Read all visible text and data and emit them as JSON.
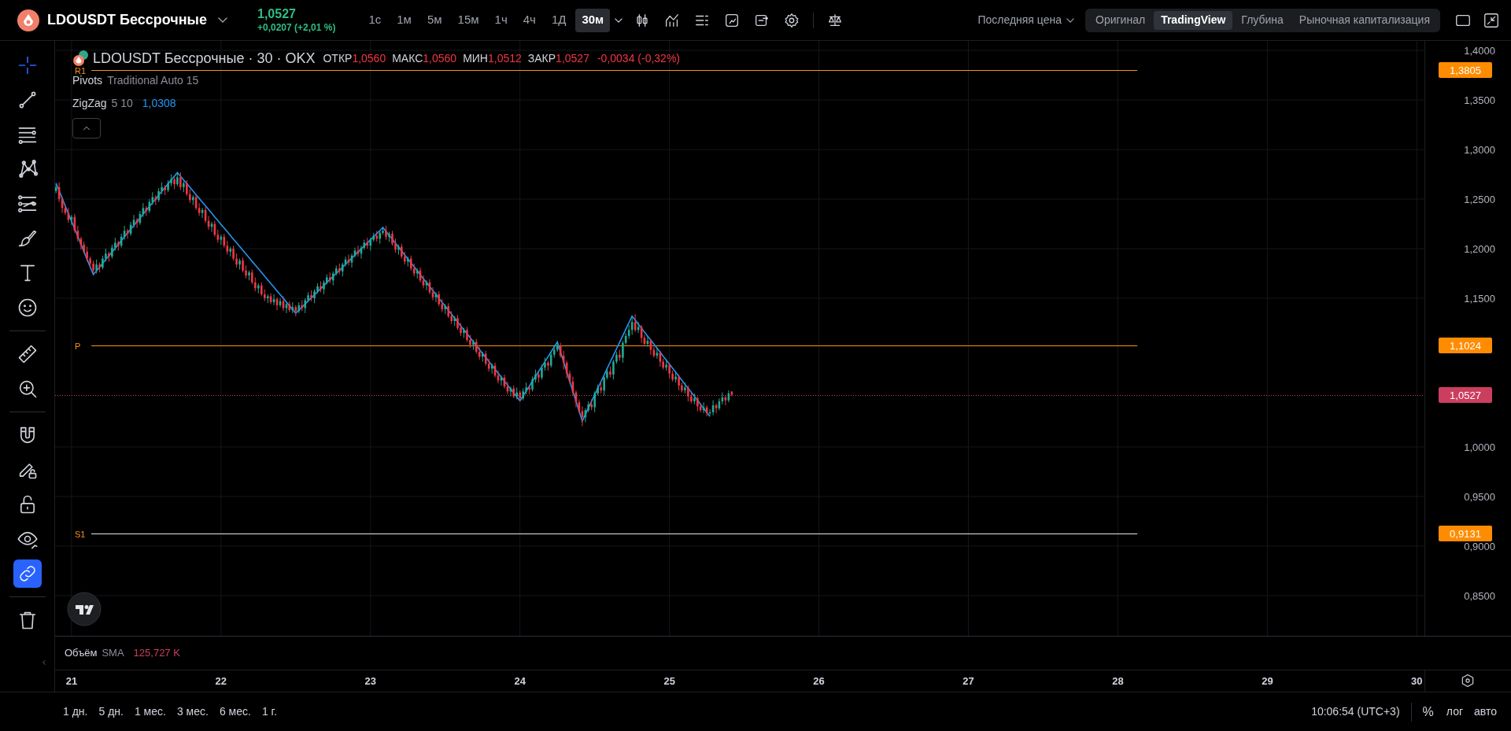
{
  "header": {
    "symbol": "LDOUSDT Бессрочные",
    "price": "1,0527",
    "change": "+0,0207 (+2,01 %)",
    "timeframes": [
      {
        "label": "1с",
        "selected": false
      },
      {
        "label": "1м",
        "selected": false
      },
      {
        "label": "5м",
        "selected": false
      },
      {
        "label": "15м",
        "selected": false
      },
      {
        "label": "1ч",
        "selected": false
      },
      {
        "label": "4ч",
        "selected": false
      },
      {
        "label": "1Д",
        "selected": false
      },
      {
        "label": "30м",
        "selected": true
      }
    ],
    "price_source": "Последняя цена",
    "views": [
      {
        "label": "Оригинал",
        "selected": false
      },
      {
        "label": "TradingView",
        "selected": true
      },
      {
        "label": "Глубина",
        "selected": false
      },
      {
        "label": "Рыночная капитализация",
        "selected": false
      }
    ]
  },
  "toolbar": {
    "tools": [
      {
        "selected": true
      },
      {
        "selected": false
      },
      {
        "selected": false
      },
      {
        "selected": false
      },
      {
        "selected": false
      },
      {
        "selected": false
      },
      {
        "selected": false
      },
      {
        "selected": false
      }
    ],
    "link_drawings": {
      "on": true
    }
  },
  "legend": {
    "symbol": "LDOUSDT Бессрочные · 30 · OKX",
    "ohlc": [
      {
        "label": "ОТКР",
        "value": "1,0560"
      },
      {
        "label": "МАКС",
        "value": "1,0560"
      },
      {
        "label": "МИН",
        "value": "1,0512"
      },
      {
        "label": "ЗАКР",
        "value": "1,0527"
      }
    ],
    "change": "-0,0034 (-0,32%)",
    "indicators": [
      {
        "name": "Pivots",
        "params": "Traditional Auto 15"
      },
      {
        "params": "5 10",
        "value": "1,0308"
      }
    ]
  },
  "chart": {
    "chart_data": {
      "type": "candlestick",
      "grid": true,
      "x": [
        20.896,
        20.917,
        20.938,
        20.958,
        20.979,
        21.0,
        21.021,
        21.042,
        21.063,
        21.083,
        21.104,
        21.125,
        21.146,
        21.167,
        21.188,
        21.208,
        21.229,
        21.25,
        21.271,
        21.292,
        21.313,
        21.333,
        21.354,
        21.375,
        21.396,
        21.417,
        21.438,
        21.458,
        21.479,
        21.5,
        21.521,
        21.542,
        21.563,
        21.583,
        21.604,
        21.625,
        21.646,
        21.667,
        21.688,
        21.708,
        21.729,
        21.75,
        21.771,
        21.792,
        21.813,
        21.833,
        21.854,
        21.875,
        21.896,
        21.917,
        21.938,
        21.958,
        21.979,
        22.0,
        22.021,
        22.042,
        22.063,
        22.083,
        22.104,
        22.125,
        22.146,
        22.167,
        22.188,
        22.208,
        22.229,
        22.25,
        22.271,
        22.292,
        22.313,
        22.333,
        22.354,
        22.375,
        22.396,
        22.417,
        22.438,
        22.458,
        22.479,
        22.5,
        22.521,
        22.542,
        22.563,
        22.583,
        22.604,
        22.625,
        22.646,
        22.667,
        22.688,
        22.708,
        22.729,
        22.75,
        22.771,
        22.792,
        22.813,
        22.833,
        22.854,
        22.875,
        22.896,
        22.917,
        22.938,
        22.958,
        22.979,
        23.0,
        23.021,
        23.042,
        23.063,
        23.083,
        23.104,
        23.125,
        23.146,
        23.167,
        23.188,
        23.208,
        23.229,
        23.25,
        23.271,
        23.292,
        23.313,
        23.333,
        23.354,
        23.375,
        23.396,
        23.417,
        23.438,
        23.458,
        23.479,
        23.5,
        23.521,
        23.542,
        23.563,
        23.583,
        23.604,
        23.625,
        23.646,
        23.667,
        23.688,
        23.708,
        23.729,
        23.75,
        23.771,
        23.792,
        23.813,
        23.833,
        23.854,
        23.875,
        23.896,
        23.917,
        23.938,
        23.958,
        23.979,
        24.0,
        24.021,
        24.042,
        24.063,
        24.083,
        24.104,
        24.125,
        24.146,
        24.167,
        24.188,
        24.208,
        24.229,
        24.25,
        24.271,
        24.292,
        24.313,
        24.333,
        24.354,
        24.375,
        24.396,
        24.417,
        24.438,
        24.458,
        24.479,
        24.5,
        24.521,
        24.542,
        24.563,
        24.583,
        24.604,
        24.625,
        24.646,
        24.667,
        24.688,
        24.708,
        24.729,
        24.75,
        24.771,
        24.792,
        24.813,
        24.833,
        24.854,
        24.875,
        24.896,
        24.917,
        24.938,
        24.958,
        24.979,
        25.0,
        25.021,
        25.042,
        25.063,
        25.083,
        25.104,
        25.125,
        25.146,
        25.167,
        25.188,
        25.208,
        25.229,
        25.25,
        25.271,
        25.292,
        25.313,
        25.333,
        25.354,
        25.375,
        25.396,
        25.417
      ],
      "ohlc": [
        [
          1.258,
          1.265,
          1.256,
          1.262
        ],
        [
          1.262,
          1.267,
          1.247,
          1.25
        ],
        [
          1.25,
          1.252,
          1.236,
          1.241
        ],
        [
          1.241,
          1.244,
          1.234,
          1.236
        ],
        [
          1.236,
          1.241,
          1.226,
          1.229
        ],
        [
          1.229,
          1.234,
          1.224,
          1.232
        ],
        [
          1.232,
          1.235,
          1.216,
          1.218
        ],
        [
          1.218,
          1.223,
          1.207,
          1.21
        ],
        [
          1.21,
          1.212,
          1.199,
          1.204
        ],
        [
          1.204,
          1.207,
          1.195,
          1.197
        ],
        [
          1.197,
          1.202,
          1.187,
          1.19
        ],
        [
          1.19,
          1.192,
          1.18,
          1.185
        ],
        [
          1.185,
          1.188,
          1.174,
          1.178
        ],
        [
          1.178,
          1.189,
          1.175,
          1.184
        ],
        [
          1.184,
          1.186,
          1.176,
          1.181
        ],
        [
          1.181,
          1.193,
          1.179,
          1.19
        ],
        [
          1.19,
          1.2,
          1.187,
          1.195
        ],
        [
          1.195,
          1.197,
          1.187,
          1.192
        ],
        [
          1.192,
          1.204,
          1.19,
          1.201
        ],
        [
          1.201,
          1.211,
          1.198,
          1.206
        ],
        [
          1.206,
          1.208,
          1.198,
          1.203
        ],
        [
          1.203,
          1.215,
          1.201,
          1.212
        ],
        [
          1.212,
          1.223,
          1.209,
          1.218
        ],
        [
          1.218,
          1.22,
          1.21,
          1.215
        ],
        [
          1.215,
          1.227,
          1.213,
          1.224
        ],
        [
          1.224,
          1.234,
          1.221,
          1.229
        ],
        [
          1.229,
          1.231,
          1.221,
          1.226
        ],
        [
          1.226,
          1.238,
          1.224,
          1.235
        ],
        [
          1.235,
          1.246,
          1.232,
          1.241
        ],
        [
          1.241,
          1.243,
          1.233,
          1.238
        ],
        [
          1.238,
          1.25,
          1.236,
          1.247
        ],
        [
          1.247,
          1.257,
          1.244,
          1.252
        ],
        [
          1.252,
          1.254,
          1.244,
          1.249
        ],
        [
          1.249,
          1.261,
          1.247,
          1.258
        ],
        [
          1.258,
          1.267,
          1.255,
          1.262
        ],
        [
          1.262,
          1.264,
          1.254,
          1.259
        ],
        [
          1.259,
          1.269,
          1.257,
          1.266
        ],
        [
          1.266,
          1.275,
          1.263,
          1.27
        ],
        [
          1.27,
          1.272,
          1.26,
          1.265
        ],
        [
          1.265,
          1.277,
          1.263,
          1.272
        ],
        [
          1.272,
          1.277,
          1.259,
          1.262
        ],
        [
          1.262,
          1.268,
          1.257,
          1.266
        ],
        [
          1.266,
          1.269,
          1.253,
          1.255
        ],
        [
          1.255,
          1.26,
          1.246,
          1.249
        ],
        [
          1.249,
          1.254,
          1.244,
          1.252
        ],
        [
          1.252,
          1.255,
          1.239,
          1.241
        ],
        [
          1.241,
          1.246,
          1.233,
          1.236
        ],
        [
          1.236,
          1.241,
          1.231,
          1.239
        ],
        [
          1.239,
          1.242,
          1.226,
          1.228
        ],
        [
          1.228,
          1.233,
          1.219,
          1.222
        ],
        [
          1.222,
          1.227,
          1.217,
          1.225
        ],
        [
          1.225,
          1.228,
          1.212,
          1.214
        ],
        [
          1.214,
          1.219,
          1.206,
          1.209
        ],
        [
          1.209,
          1.214,
          1.204,
          1.212
        ],
        [
          1.212,
          1.215,
          1.201,
          1.203
        ],
        [
          1.203,
          1.208,
          1.194,
          1.197
        ],
        [
          1.197,
          1.202,
          1.192,
          1.2
        ],
        [
          1.2,
          1.203,
          1.188,
          1.19
        ],
        [
          1.19,
          1.195,
          1.181,
          1.184
        ],
        [
          1.184,
          1.19,
          1.179,
          1.188
        ],
        [
          1.188,
          1.191,
          1.176,
          1.178
        ],
        [
          1.178,
          1.183,
          1.17,
          1.173
        ],
        [
          1.173,
          1.178,
          1.168,
          1.176
        ],
        [
          1.176,
          1.179,
          1.164,
          1.166
        ],
        [
          1.166,
          1.171,
          1.157,
          1.16
        ],
        [
          1.16,
          1.165,
          1.155,
          1.163
        ],
        [
          1.163,
          1.166,
          1.152,
          1.154
        ],
        [
          1.154,
          1.159,
          1.147,
          1.15
        ],
        [
          1.15,
          1.154,
          1.145,
          1.152
        ],
        [
          1.152,
          1.155,
          1.144,
          1.146
        ],
        [
          1.146,
          1.154,
          1.143,
          1.149
        ],
        [
          1.149,
          1.151,
          1.138,
          1.143
        ],
        [
          1.143,
          1.15,
          1.141,
          1.147
        ],
        [
          1.147,
          1.152,
          1.137,
          1.14
        ],
        [
          1.14,
          1.146,
          1.135,
          1.144
        ],
        [
          1.144,
          1.147,
          1.136,
          1.138
        ],
        [
          1.138,
          1.146,
          1.135,
          1.141
        ],
        [
          1.141,
          1.143,
          1.132,
          1.137
        ],
        [
          1.137,
          1.146,
          1.135,
          1.143
        ],
        [
          1.143,
          1.148,
          1.137,
          1.14
        ],
        [
          1.14,
          1.15,
          1.135,
          1.148
        ],
        [
          1.148,
          1.156,
          1.146,
          1.153
        ],
        [
          1.153,
          1.158,
          1.147,
          1.15
        ],
        [
          1.15,
          1.159,
          1.145,
          1.157
        ],
        [
          1.157,
          1.165,
          1.155,
          1.162
        ],
        [
          1.162,
          1.167,
          1.156,
          1.159
        ],
        [
          1.159,
          1.168,
          1.154,
          1.166
        ],
        [
          1.166,
          1.174,
          1.164,
          1.171
        ],
        [
          1.171,
          1.176,
          1.165,
          1.168
        ],
        [
          1.168,
          1.177,
          1.163,
          1.175
        ],
        [
          1.175,
          1.183,
          1.173,
          1.18
        ],
        [
          1.18,
          1.185,
          1.174,
          1.177
        ],
        [
          1.177,
          1.186,
          1.172,
          1.184
        ],
        [
          1.184,
          1.192,
          1.182,
          1.189
        ],
        [
          1.189,
          1.194,
          1.183,
          1.186
        ],
        [
          1.186,
          1.195,
          1.181,
          1.193
        ],
        [
          1.193,
          1.201,
          1.191,
          1.198
        ],
        [
          1.198,
          1.203,
          1.192,
          1.195
        ],
        [
          1.195,
          1.203,
          1.19,
          1.201
        ],
        [
          1.201,
          1.209,
          1.199,
          1.206
        ],
        [
          1.206,
          1.211,
          1.2,
          1.203
        ],
        [
          1.203,
          1.211,
          1.198,
          1.209
        ],
        [
          1.209,
          1.216,
          1.207,
          1.213
        ],
        [
          1.213,
          1.218,
          1.207,
          1.21
        ],
        [
          1.21,
          1.218,
          1.205,
          1.216
        ],
        [
          1.216,
          1.221,
          1.214,
          1.218
        ],
        [
          1.218,
          1.223,
          1.209,
          1.212
        ],
        [
          1.212,
          1.217,
          1.207,
          1.215
        ],
        [
          1.215,
          1.218,
          1.203,
          1.205
        ],
        [
          1.205,
          1.21,
          1.196,
          1.199
        ],
        [
          1.199,
          1.204,
          1.194,
          1.202
        ],
        [
          1.202,
          1.205,
          1.19,
          1.192
        ],
        [
          1.192,
          1.197,
          1.184,
          1.187
        ],
        [
          1.187,
          1.192,
          1.182,
          1.19
        ],
        [
          1.19,
          1.193,
          1.178,
          1.18
        ],
        [
          1.18,
          1.185,
          1.172,
          1.175
        ],
        [
          1.175,
          1.18,
          1.17,
          1.178
        ],
        [
          1.178,
          1.181,
          1.166,
          1.168
        ],
        [
          1.168,
          1.173,
          1.16,
          1.163
        ],
        [
          1.163,
          1.168,
          1.158,
          1.166
        ],
        [
          1.166,
          1.169,
          1.154,
          1.156
        ],
        [
          1.156,
          1.161,
          1.148,
          1.151
        ],
        [
          1.151,
          1.156,
          1.146,
          1.154
        ],
        [
          1.154,
          1.157,
          1.142,
          1.144
        ],
        [
          1.144,
          1.149,
          1.136,
          1.139
        ],
        [
          1.139,
          1.144,
          1.134,
          1.142
        ],
        [
          1.142,
          1.145,
          1.13,
          1.132
        ],
        [
          1.132,
          1.137,
          1.124,
          1.127
        ],
        [
          1.127,
          1.132,
          1.122,
          1.13
        ],
        [
          1.13,
          1.133,
          1.118,
          1.12
        ],
        [
          1.12,
          1.125,
          1.112,
          1.115
        ],
        [
          1.115,
          1.12,
          1.11,
          1.118
        ],
        [
          1.118,
          1.121,
          1.106,
          1.108
        ],
        [
          1.108,
          1.113,
          1.1,
          1.103
        ],
        [
          1.103,
          1.108,
          1.098,
          1.106
        ],
        [
          1.106,
          1.109,
          1.094,
          1.096
        ],
        [
          1.096,
          1.101,
          1.088,
          1.091
        ],
        [
          1.091,
          1.096,
          1.086,
          1.094
        ],
        [
          1.094,
          1.097,
          1.082,
          1.084
        ],
        [
          1.084,
          1.089,
          1.076,
          1.079
        ],
        [
          1.079,
          1.084,
          1.074,
          1.082
        ],
        [
          1.082,
          1.085,
          1.07,
          1.072
        ],
        [
          1.072,
          1.077,
          1.064,
          1.067
        ],
        [
          1.067,
          1.072,
          1.062,
          1.07
        ],
        [
          1.07,
          1.073,
          1.059,
          1.061
        ],
        [
          1.061,
          1.066,
          1.053,
          1.056
        ],
        [
          1.056,
          1.061,
          1.051,
          1.059
        ],
        [
          1.059,
          1.062,
          1.049,
          1.051
        ],
        [
          1.051,
          1.06,
          1.048,
          1.055
        ],
        [
          1.055,
          1.057,
          1.046,
          1.049
        ],
        [
          1.049,
          1.059,
          1.047,
          1.056
        ],
        [
          1.056,
          1.065,
          1.053,
          1.06
        ],
        [
          1.06,
          1.062,
          1.053,
          1.058
        ],
        [
          1.058,
          1.071,
          1.056,
          1.068
        ],
        [
          1.068,
          1.078,
          1.065,
          1.073
        ],
        [
          1.073,
          1.075,
          1.065,
          1.07
        ],
        [
          1.07,
          1.083,
          1.068,
          1.08
        ],
        [
          1.08,
          1.09,
          1.077,
          1.085
        ],
        [
          1.085,
          1.087,
          1.077,
          1.082
        ],
        [
          1.082,
          1.096,
          1.08,
          1.093
        ],
        [
          1.093,
          1.103,
          1.09,
          1.098
        ],
        [
          1.098,
          1.106,
          1.096,
          1.102
        ],
        [
          1.102,
          1.105,
          1.09,
          1.092
        ],
        [
          1.092,
          1.097,
          1.078,
          1.085
        ],
        [
          1.085,
          1.087,
          1.069,
          1.074
        ],
        [
          1.074,
          1.077,
          1.064,
          1.066
        ],
        [
          1.066,
          1.071,
          1.052,
          1.055
        ],
        [
          1.055,
          1.057,
          1.04,
          1.045
        ],
        [
          1.045,
          1.048,
          1.034,
          1.036
        ],
        [
          1.036,
          1.041,
          1.021,
          1.03
        ],
        [
          1.03,
          1.039,
          1.025,
          1.037
        ],
        [
          1.037,
          1.046,
          1.035,
          1.043
        ],
        [
          1.043,
          1.048,
          1.037,
          1.04
        ],
        [
          1.04,
          1.056,
          1.035,
          1.054
        ],
        [
          1.054,
          1.063,
          1.052,
          1.06
        ],
        [
          1.06,
          1.065,
          1.054,
          1.057
        ],
        [
          1.057,
          1.072,
          1.052,
          1.07
        ],
        [
          1.07,
          1.079,
          1.068,
          1.076
        ],
        [
          1.076,
          1.081,
          1.07,
          1.073
        ],
        [
          1.073,
          1.088,
          1.068,
          1.086
        ],
        [
          1.086,
          1.096,
          1.084,
          1.093
        ],
        [
          1.093,
          1.098,
          1.087,
          1.09
        ],
        [
          1.09,
          1.107,
          1.085,
          1.105
        ],
        [
          1.105,
          1.115,
          1.103,
          1.112
        ],
        [
          1.112,
          1.123,
          1.109,
          1.118
        ],
        [
          1.118,
          1.132,
          1.113,
          1.126
        ],
        [
          1.126,
          1.134,
          1.116,
          1.118
        ],
        [
          1.118,
          1.126,
          1.115,
          1.121
        ],
        [
          1.121,
          1.123,
          1.105,
          1.11
        ],
        [
          1.11,
          1.113,
          1.102,
          1.104
        ],
        [
          1.104,
          1.112,
          1.101,
          1.107
        ],
        [
          1.107,
          1.109,
          1.093,
          1.098
        ],
        [
          1.098,
          1.101,
          1.09,
          1.092
        ],
        [
          1.092,
          1.1,
          1.089,
          1.095
        ],
        [
          1.095,
          1.097,
          1.081,
          1.086
        ],
        [
          1.086,
          1.089,
          1.078,
          1.08
        ],
        [
          1.08,
          1.088,
          1.077,
          1.083
        ],
        [
          1.083,
          1.085,
          1.069,
          1.074
        ],
        [
          1.074,
          1.077,
          1.066,
          1.068
        ],
        [
          1.068,
          1.076,
          1.065,
          1.071
        ],
        [
          1.071,
          1.073,
          1.057,
          1.062
        ],
        [
          1.062,
          1.065,
          1.055,
          1.057
        ],
        [
          1.057,
          1.065,
          1.054,
          1.06
        ],
        [
          1.06,
          1.062,
          1.046,
          1.051
        ],
        [
          1.051,
          1.054,
          1.044,
          1.046
        ],
        [
          1.046,
          1.054,
          1.043,
          1.049
        ],
        [
          1.049,
          1.051,
          1.036,
          1.041
        ],
        [
          1.041,
          1.044,
          1.035,
          1.037
        ],
        [
          1.037,
          1.045,
          1.034,
          1.04
        ],
        [
          1.04,
          1.042,
          1.031,
          1.034
        ],
        [
          1.034,
          1.038,
          1.032,
          1.035
        ],
        [
          1.035,
          1.047,
          1.032,
          1.042
        ],
        [
          1.042,
          1.044,
          1.034,
          1.039
        ],
        [
          1.039,
          1.049,
          1.037,
          1.046
        ],
        [
          1.046,
          1.055,
          1.043,
          1.05
        ],
        [
          1.05,
          1.052,
          1.042,
          1.047
        ],
        [
          1.047,
          1.057,
          1.045,
          1.054
        ],
        [
          1.056,
          1.056,
          1.0512,
          1.0527
        ]
      ],
      "series": [
        {
          "name": "ZigZag",
          "type": "line",
          "color": "#2196f3",
          "values": [
            1.2661,
            1.2584,
            1.2507,
            1.243,
            1.2353,
            1.2276,
            1.22,
            1.2123,
            1.2046,
            1.1969,
            1.1892,
            1.1815,
            1.1738,
            1.1776,
            1.1814,
            1.1852,
            1.1891,
            1.1929,
            1.1967,
            1.2005,
            1.2043,
            1.2081,
            1.212,
            1.2158,
            1.2196,
            1.2234,
            1.2272,
            1.231,
            1.2348,
            1.2387,
            1.2425,
            1.2463,
            1.2501,
            1.2539,
            1.2577,
            1.2615,
            1.2654,
            1.2692,
            1.273,
            1.2768,
            1.2731,
            1.2693,
            1.2656,
            1.2619,
            1.2581,
            1.2544,
            1.2507,
            1.2469,
            1.2432,
            1.2395,
            1.2357,
            1.232,
            1.2283,
            1.2245,
            1.2208,
            1.2171,
            1.2133,
            1.2096,
            1.2059,
            1.2021,
            1.1984,
            1.1947,
            1.1909,
            1.1872,
            1.1835,
            1.1797,
            1.176,
            1.1723,
            1.1685,
            1.1648,
            1.1611,
            1.1573,
            1.1536,
            1.1499,
            1.1461,
            1.1424,
            1.1387,
            1.1349,
            1.138,
            1.1411,
            1.1442,
            1.1473,
            1.1503,
            1.1534,
            1.1565,
            1.1596,
            1.1627,
            1.1658,
            1.1689,
            1.172,
            1.175,
            1.1781,
            1.1812,
            1.1843,
            1.1874,
            1.1905,
            1.1936,
            1.1967,
            1.1997,
            1.2028,
            1.2059,
            1.209,
            1.2121,
            1.2152,
            1.2183,
            1.2214,
            1.2174,
            1.2134,
            1.2095,
            1.2055,
            1.2015,
            1.1976,
            1.1936,
            1.1896,
            1.1856,
            1.1817,
            1.1777,
            1.1737,
            1.1697,
            1.1658,
            1.1618,
            1.1578,
            1.1539,
            1.1499,
            1.1459,
            1.142,
            1.138,
            1.134,
            1.13,
            1.1261,
            1.1221,
            1.1181,
            1.1142,
            1.1102,
            1.1062,
            1.1023,
            1.0983,
            1.0943,
            1.0903,
            1.0864,
            1.0824,
            1.0784,
            1.0745,
            1.0705,
            1.0665,
            1.0624,
            1.0584,
            1.0545,
            1.0505,
            1.0465,
            1.0514,
            1.0564,
            1.0613,
            1.0663,
            1.0712,
            1.0762,
            1.0811,
            1.086,
            1.091,
            1.0959,
            1.1009,
            1.1058,
            1.0959,
            1.0859,
            1.076,
            1.066,
            1.0561,
            1.0461,
            1.0362,
            1.0262,
            1.0328,
            1.0394,
            1.046,
            1.0527,
            1.0593,
            1.0659,
            1.0725,
            1.0791,
            1.0857,
            1.0924,
            1.099,
            1.1056,
            1.1122,
            1.1188,
            1.1254,
            1.132,
            1.128,
            1.1239,
            1.1199,
            1.1158,
            1.1118,
            1.1077,
            1.1037,
            1.0996,
            1.0956,
            1.0915,
            1.0875,
            1.0835,
            1.0794,
            1.0754,
            1.0713,
            1.0673,
            1.0632,
            1.0592,
            1.0551,
            1.0511,
            1.047,
            1.043,
            1.0389,
            1.0349,
            1.0308,
            null,
            null,
            null,
            null,
            null,
            null,
            null
          ]
        }
      ],
      "ref_lines": [
        {
          "axis": "y",
          "label": "R1",
          "value": 1.3805,
          "color": "#f7931a"
        },
        {
          "axis": "y",
          "label": "P",
          "value": 1.1024,
          "color": "#f7931a"
        },
        {
          "axis": "y",
          "value": 1.0527,
          "color": "#cc3e5e"
        },
        {
          "axis": "y",
          "label": "S1",
          "value": 0.9131,
          "color": "#e6e6e6"
        }
      ],
      "xlim": [
        20.89,
        30.63
      ],
      "ylim": [
        0.7135,
        1.4508
      ],
      "xticks": [
        {
          "value": 21,
          "label": "21"
        },
        {
          "value": 22,
          "label": "22"
        },
        {
          "value": 23,
          "label": "23"
        },
        {
          "value": 24,
          "label": "24"
        },
        {
          "value": 25,
          "label": "25"
        },
        {
          "value": 26,
          "label": "26"
        },
        {
          "value": 27,
          "label": "27"
        },
        {
          "value": 28,
          "label": "28"
        },
        {
          "value": 29,
          "label": "29"
        },
        {
          "value": 30,
          "label": "30"
        }
      ],
      "yticks": [
        {
          "value": 0.85,
          "label": "0,8500"
        },
        {
          "value": 0.9,
          "label": "0,9000"
        },
        {
          "value": 0.95,
          "label": "0,9500"
        },
        {
          "value": 1.0,
          "label": "1,0000"
        },
        {
          "value": 1.15,
          "label": "1,1500"
        },
        {
          "value": 1.2,
          "label": "1,2000"
        },
        {
          "value": 1.25,
          "label": "1,2500"
        },
        {
          "value": 1.3,
          "label": "1,3000"
        },
        {
          "value": 1.35,
          "label": "1,3500"
        },
        {
          "value": 1.4,
          "label": "1,4000"
        }
      ]
    },
    "axis_badges": [
      {
        "text": "1,3805",
        "color": "#ff8c00"
      },
      {
        "text": "1,1024",
        "color": "#ff8c00"
      },
      {
        "text": "1,0527",
        "color": "#cc3e5e"
      },
      {
        "text": "0,9131",
        "color": "#ff8c00"
      }
    ]
  },
  "volume": {
    "name": "Объём",
    "params": "SMA",
    "value": "125,727 K"
  },
  "range_buttons": [
    "1 дн.",
    "5 дн.",
    "1 мес.",
    "3 мес.",
    "6 мес.",
    "1 г."
  ],
  "status": {
    "time": "10:06:54 (UTC+3)",
    "percent": "%",
    "log": "лог",
    "auto": "авто"
  }
}
